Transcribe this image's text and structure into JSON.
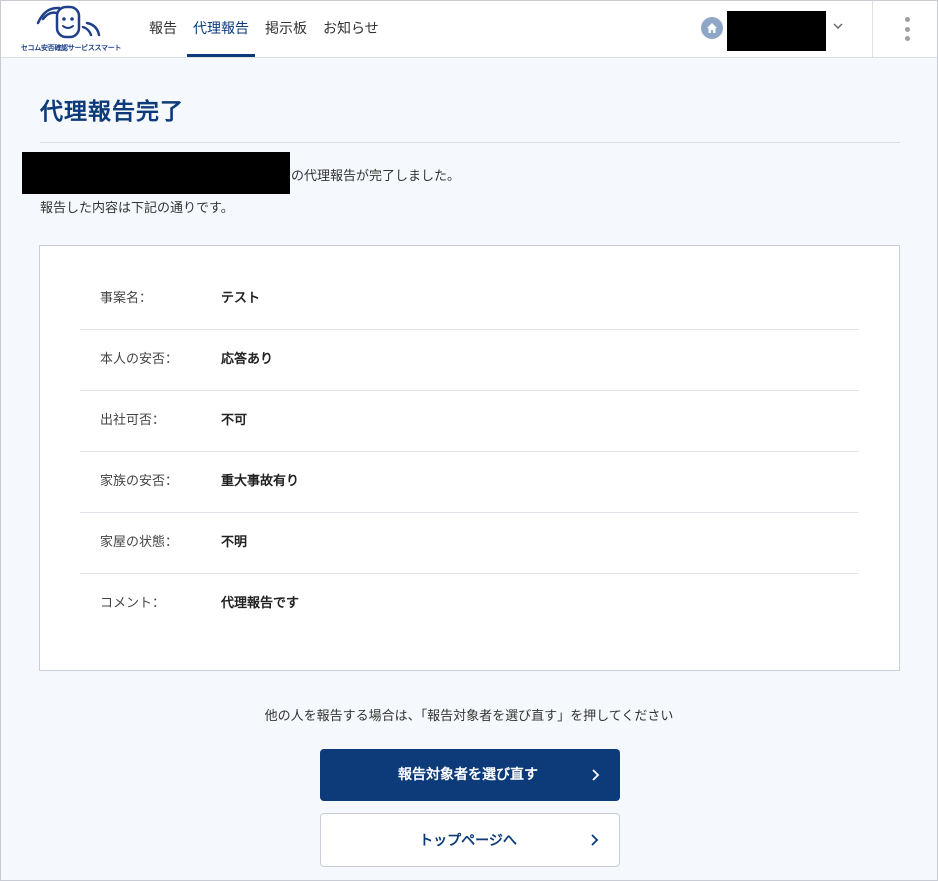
{
  "header": {
    "logo_text": "セコム安否確認サービススマート",
    "nav": [
      {
        "label": "報告",
        "active": false
      },
      {
        "label": "代理報告",
        "active": true
      },
      {
        "label": "掲示板",
        "active": false
      },
      {
        "label": "お知らせ",
        "active": false
      }
    ],
    "icons": [
      "home-icon",
      "chevron-down-icon",
      "more-vertical-icon"
    ]
  },
  "main": {
    "title": "代理報告完了",
    "message_line1": "の代理報告が完了しました。",
    "message_line2": "報告した内容は下記の通りです。",
    "details": [
      {
        "label": "事案名：",
        "value": "テスト"
      },
      {
        "label": "本人の安否：",
        "value": "応答あり"
      },
      {
        "label": "出社可否：",
        "value": "不可"
      },
      {
        "label": "家族の安否：",
        "value": "重大事故有り"
      },
      {
        "label": "家屋の状態：",
        "value": "不明"
      },
      {
        "label": "コメント：",
        "value": "代理報告です"
      }
    ],
    "instruction": "他の人を報告する場合は、「報告対象者を選び直す」を押してください",
    "reselect_button": "報告対象者を選び直す",
    "top_button": "トップページへ"
  },
  "colors": {
    "brand": "#0d3b7a",
    "page_background": "#f5f8fc",
    "card_border": "#c9ced6"
  }
}
